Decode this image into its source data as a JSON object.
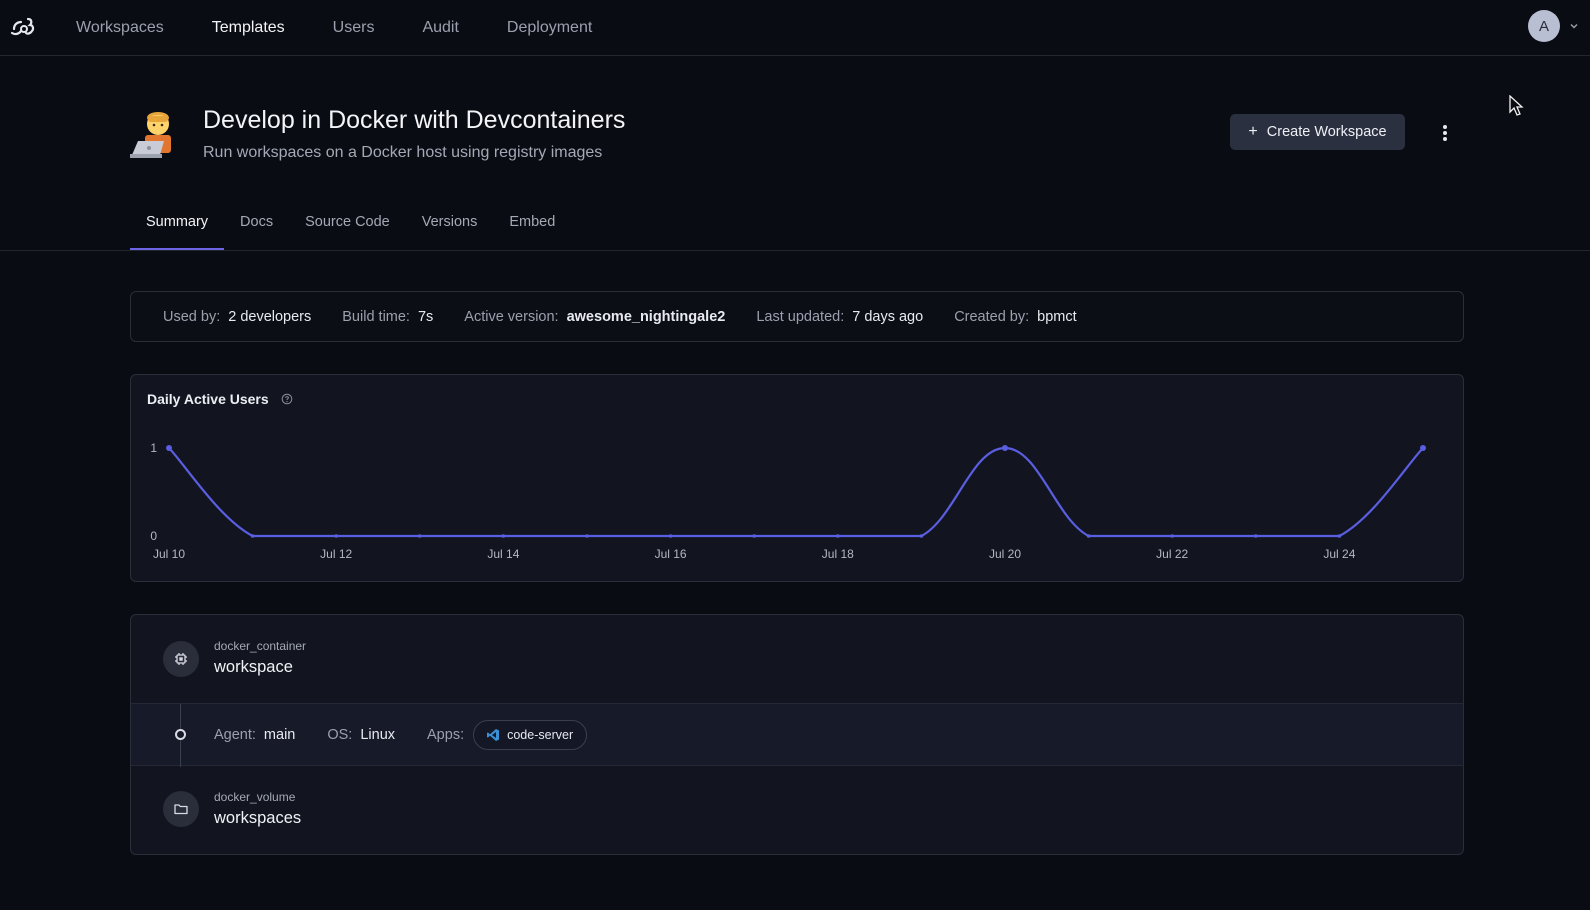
{
  "nav": {
    "items": [
      {
        "label": "Workspaces",
        "active": false
      },
      {
        "label": "Templates",
        "active": true
      },
      {
        "label": "Users",
        "active": false
      },
      {
        "label": "Audit",
        "active": false
      },
      {
        "label": "Deployment",
        "active": false
      }
    ],
    "avatar_letter": "A"
  },
  "header": {
    "title": "Develop in Docker with Devcontainers",
    "subtitle": "Run workspaces on a Docker host using registry images",
    "create_label": "Create Workspace",
    "create_icon": "plus-icon",
    "emoji_icon": "technologist-emoji-icon"
  },
  "tabs": [
    {
      "label": "Summary",
      "active": true
    },
    {
      "label": "Docs",
      "active": false
    },
    {
      "label": "Source Code",
      "active": false
    },
    {
      "label": "Versions",
      "active": false
    },
    {
      "label": "Embed",
      "active": false
    }
  ],
  "stats": [
    {
      "label": "Used by:",
      "value": "2 developers",
      "bold": false
    },
    {
      "label": "Build time:",
      "value": "7s",
      "bold": false
    },
    {
      "label": "Active version:",
      "value": "awesome_nightingale2",
      "bold": true
    },
    {
      "label": "Last updated:",
      "value": "7 days ago",
      "bold": false
    },
    {
      "label": "Created by:",
      "value": "bpmct",
      "bold": false
    }
  ],
  "chart_data": {
    "type": "line",
    "title": "Daily Active Users",
    "x": [
      "Jul 10",
      "Jul 11",
      "Jul 12",
      "Jul 13",
      "Jul 14",
      "Jul 15",
      "Jul 16",
      "Jul 17",
      "Jul 18",
      "Jul 19",
      "Jul 20",
      "Jul 21",
      "Jul 22",
      "Jul 23",
      "Jul 24",
      "Jul 25"
    ],
    "values": [
      1,
      0,
      0,
      0,
      0,
      0,
      0,
      0,
      0,
      0,
      1,
      0,
      0,
      0,
      0,
      1
    ],
    "xticks": [
      "Jul 10",
      "Jul 12",
      "Jul 14",
      "Jul 16",
      "Jul 18",
      "Jul 20",
      "Jul 22",
      "Jul 24"
    ],
    "yticks": [
      0,
      1
    ],
    "ylim": [
      0,
      1
    ],
    "grid": false,
    "color": "#5a5ee0"
  },
  "resources": [
    {
      "type": "docker_container",
      "name": "workspace",
      "icon": "chip-icon"
    },
    {
      "type": "docker_volume",
      "name": "workspaces",
      "icon": "folder-icon"
    }
  ],
  "agent": {
    "agent_label": "Agent:",
    "agent_value": "main",
    "os_label": "OS:",
    "os_value": "Linux",
    "apps_label": "Apps:",
    "app": {
      "name": "code-server",
      "icon": "vscode-icon"
    }
  },
  "colors": {
    "accent": "#6c63e5",
    "line": "#5a5ee0",
    "background": "#0a0c13"
  }
}
